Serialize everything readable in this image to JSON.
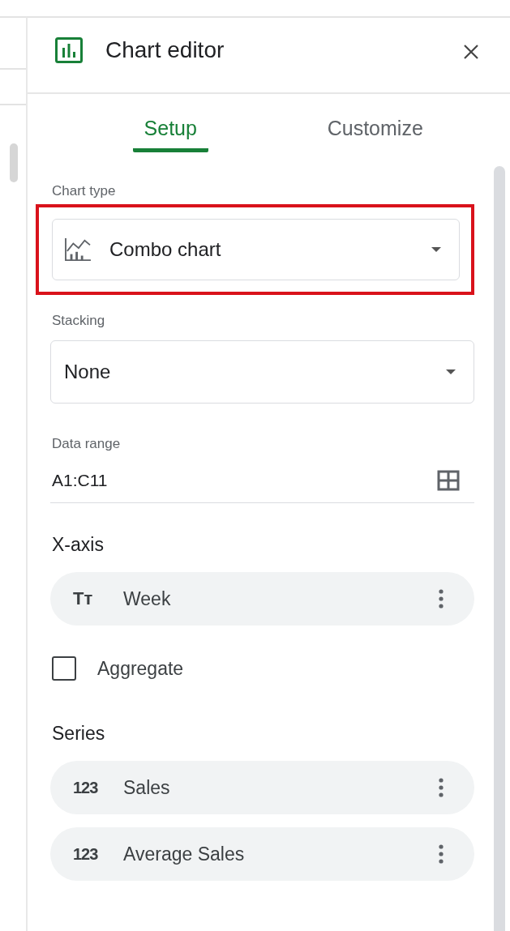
{
  "panel": {
    "title": "Chart editor"
  },
  "tabs": [
    {
      "label": "Setup",
      "selected": true
    },
    {
      "label": "Customize",
      "selected": false
    }
  ],
  "chart_type": {
    "label": "Chart type",
    "value": "Combo chart",
    "highlighted": true
  },
  "stacking": {
    "label": "Stacking",
    "value": "None"
  },
  "data_range": {
    "label": "Data range",
    "value": "A1:C11"
  },
  "x_axis": {
    "heading": "X-axis",
    "items": [
      {
        "glyph": "Tт",
        "name": "Week"
      }
    ]
  },
  "aggregate": {
    "label": "Aggregate",
    "checked": false
  },
  "series": {
    "heading": "Series",
    "items": [
      {
        "glyph": "123",
        "name": "Sales"
      },
      {
        "glyph": "123",
        "name": "Average Sales"
      }
    ]
  }
}
